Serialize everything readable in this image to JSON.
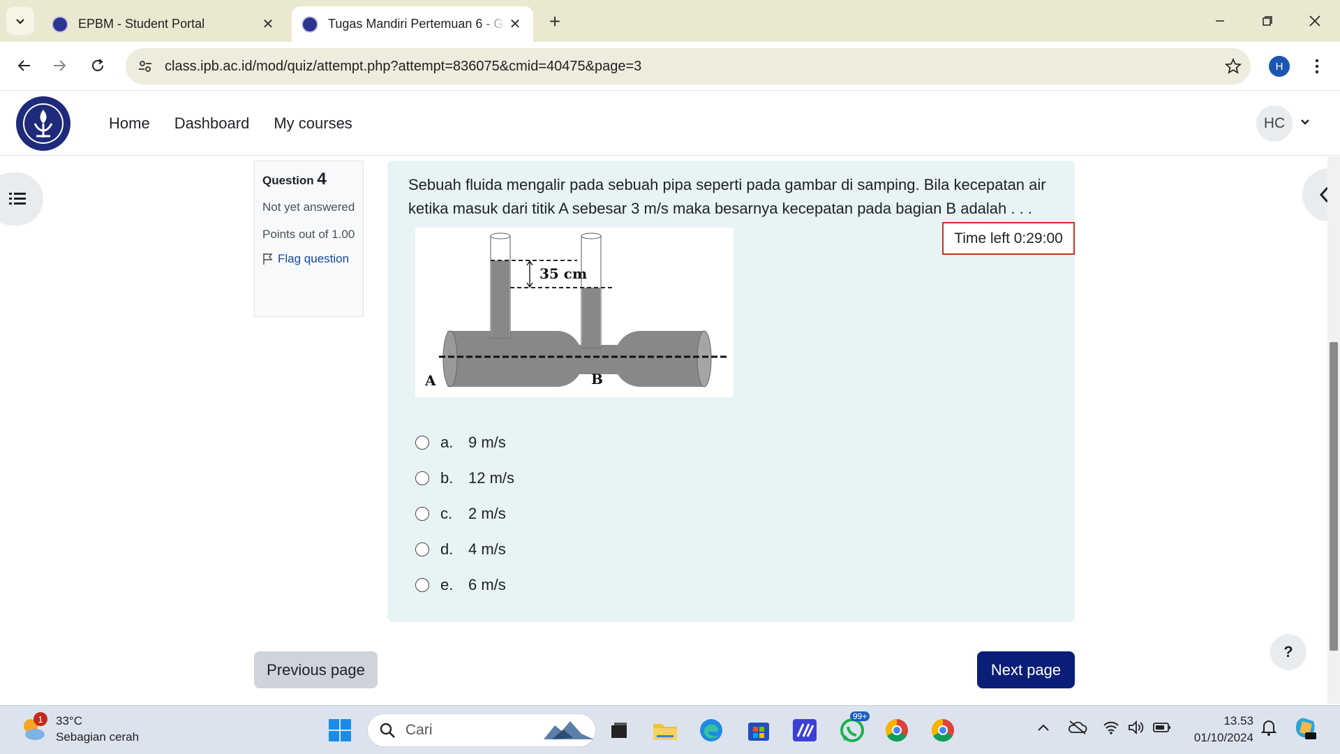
{
  "browser": {
    "tabs": [
      {
        "title": "EPBM - Student Portal",
        "active": false
      },
      {
        "title": "Tugas Mandiri Pertemuan 6 - G",
        "active": true
      }
    ],
    "url": "class.ipb.ac.id/mod/quiz/attempt.php?attempt=836075&cmid=40475&page=3",
    "profile_initial": "H"
  },
  "navbar": {
    "links": [
      "Home",
      "Dashboard",
      "My courses"
    ],
    "user_initials": "HC"
  },
  "question": {
    "label": "Question",
    "number": "4",
    "state": "Not yet answered",
    "grade": "Points out of 1.00",
    "flag": "Flag question",
    "text": "Sebuah fluida mengalir pada sebuah pipa seperti pada gambar di samping. Bila kecepatan air ketika masuk dari titik A sebesar 3 m/s maka besarnya kecepatan pada bagian B adalah . . .",
    "timer": "Time left 0:29:00",
    "figure": {
      "height_label": "35 cm",
      "point_a": "A",
      "point_b": "B"
    },
    "answers": [
      {
        "letter": "a.",
        "text": "9 m/s"
      },
      {
        "letter": "b.",
        "text": "12 m/s"
      },
      {
        "letter": "c.",
        "text": "2 m/s"
      },
      {
        "letter": "d.",
        "text": "4 m/s"
      },
      {
        "letter": "e.",
        "text": "6 m/s"
      }
    ]
  },
  "nav_buttons": {
    "previous": "Previous page",
    "next": "Next page",
    "help": "?"
  },
  "taskbar": {
    "weather": {
      "temp": "33°C",
      "desc": "Sebagian cerah",
      "badge": "1"
    },
    "search_placeholder": "Cari",
    "whatsapp_badge": "99+",
    "time": "13.53",
    "date": "01/10/2024"
  },
  "colors": {
    "accent": "#0a1e78",
    "link": "#0f47ad",
    "timer_border": "#ca3120",
    "question_bg": "#e7f3f5"
  }
}
